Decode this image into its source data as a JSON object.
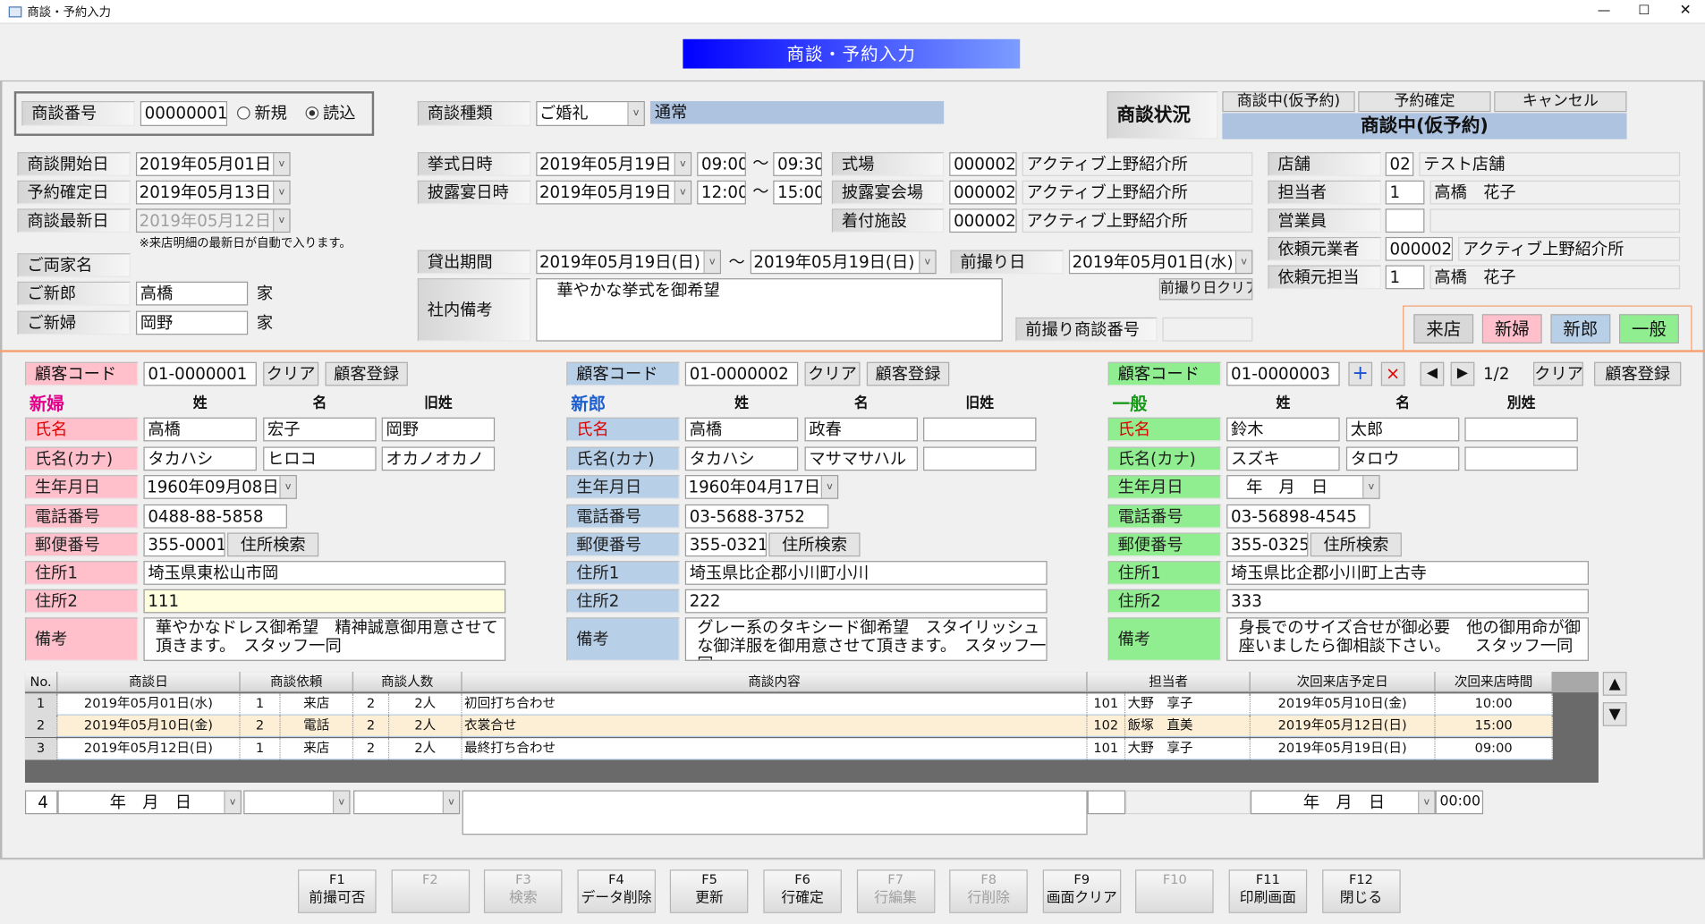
{
  "window": {
    "title": "商談・予約入力",
    "minimize": "—",
    "maximize": "☐",
    "close": "✕",
    "icon": "form-icon"
  },
  "banner": "商談・予約入力",
  "header": {
    "no_label": "商談番号",
    "no_value": "00000001",
    "radio_new": "新規",
    "radio_load": "読込",
    "radio_selected": "読込",
    "type_label": "商談種類",
    "type_value": "ご婚礼",
    "type_detail": "通常",
    "status_label": "商談状況",
    "status_tabs": [
      "商談中(仮予約)",
      "予約確定",
      "キャンセル"
    ],
    "status_value": "商談中(仮予約)"
  },
  "dates": [
    {
      "label": "商談開始日",
      "value": "2019年05月01日"
    },
    {
      "label": "予約確定日",
      "value": "2019年05月13日"
    },
    {
      "label": "商談最新日",
      "value": "2019年05月12日",
      "disabled": true
    }
  ],
  "note": "※来店明細の最新日が自動で入ります。",
  "family": {
    "label": "ご両家名",
    "groom_label": "ご新郎",
    "groom": "高橋",
    "bride_label": "ご新婦",
    "bride": "岡野",
    "suffix": "家"
  },
  "tilde": "～",
  "schedule": [
    {
      "label": "挙式日時",
      "date": "2019年05月19日",
      "start": "09:00",
      "end": "09:30"
    },
    {
      "label": "披露宴日時",
      "date": "2019年05月19日",
      "start": "12:00",
      "end": "15:00"
    }
  ],
  "venues": [
    {
      "label": "式場",
      "code": "000002",
      "name": "アクティブ上野紹介所"
    },
    {
      "label": "披露宴会場",
      "code": "000002",
      "name": "アクティブ上野紹介所"
    },
    {
      "label": "着付施設",
      "code": "000002",
      "name": "アクティブ上野紹介所"
    }
  ],
  "rental": {
    "label": "貸出期間",
    "from": "2019年05月19日(日)",
    "to": "2019年05月19日(日)"
  },
  "prephoto": {
    "label": "前撮り日",
    "date": "2019年05月01日(水)",
    "clear": "前撮り日クリア",
    "no_label": "前撮り商談番号",
    "no_value": ""
  },
  "memo": {
    "label": "社内備考",
    "value": "華やかな挙式を御希望"
  },
  "staff": [
    {
      "label": "店舗",
      "code": "02",
      "name": "テスト店舗"
    },
    {
      "label": "担当者",
      "code": "1",
      "name": "高橋　花子"
    },
    {
      "label": "営業員",
      "code": "",
      "name": ""
    },
    {
      "label": "依頼元業者",
      "code": "000002",
      "name": "アクティブ上野紹介所"
    },
    {
      "label": "依頼元担当",
      "code": "1",
      "name": "高橋　花子"
    }
  ],
  "filters": [
    {
      "label": "来店",
      "color": "#d8d8d8"
    },
    {
      "label": "新婦",
      "color": "#ffc0cb"
    },
    {
      "label": "新郎",
      "color": "#b8cfe8"
    },
    {
      "label": "一般",
      "color": "#90ee90"
    }
  ],
  "customer_labels": [
    "氏名",
    "氏名(カナ)",
    "生年月日",
    "電話番号",
    "郵便番号",
    "住所1",
    "住所2",
    "備考"
  ],
  "code_label": "顧客コード",
  "clear": "クリア",
  "register": "顧客登録",
  "search": "住所検索",
  "pager": {
    "add": "+",
    "delete": "×",
    "prev": "◀",
    "next": "▶",
    "page": "1/2"
  },
  "customers": [
    {
      "section": "新婦",
      "section_color": "#e0008a",
      "color": "#ffc0cb",
      "code": "01-0000001",
      "cols": [
        "姓",
        "名",
        "旧姓"
      ],
      "name": [
        "高橋",
        "宏子",
        "岡野"
      ],
      "kana": [
        "タカハシ",
        "ヒロコ",
        "オカノオカノ"
      ],
      "birth": "1960年09月08日",
      "phone": "0488-88-5858",
      "zip": "355-0001",
      "addr1": "埼玉県東松山市岡",
      "addr2": "111",
      "memo": "華やかなドレス御希望　精神誠意御用意させて頂きます。　スタッフ一同"
    },
    {
      "section": "新郎",
      "section_color": "#1e5fd0",
      "color": "#b8cfe8",
      "code": "01-0000002",
      "cols": [
        "姓",
        "名",
        "旧姓"
      ],
      "name": [
        "高橋",
        "政春",
        ""
      ],
      "kana": [
        "タカハシ",
        "マサマサハル",
        ""
      ],
      "birth": "1960年04月17日",
      "phone": "03-5688-3752",
      "zip": "355-0321",
      "addr1": "埼玉県比企郡小川町小川",
      "addr2": "222",
      "memo": "グレー系のタキシード御希望　スタイリッシュな御洋服を御用意させて頂きます。　スタッフ一同"
    },
    {
      "section": "一般",
      "section_color": "#1a9a1a",
      "color": "#90ee90",
      "code": "01-0000003",
      "cols": [
        "姓",
        "名",
        "別姓"
      ],
      "name": [
        "鈴木",
        "太郎",
        ""
      ],
      "kana": [
        "スズキ",
        "タロウ",
        ""
      ],
      "birth": "　年　月　日",
      "phone": "03-56898-4545",
      "zip": "355-0325",
      "addr1": "埼玉県比企郡小川町上古寺",
      "addr2": "333",
      "memo": "身長でのサイズ合せが御必要　他の御用命が御座いましたら御相談下さい。　　スタッフ一同"
    }
  ],
  "grid": {
    "columns": [
      "No.",
      "商談日",
      "商談依頼",
      "商談人数",
      "商談内容",
      "担当者",
      "次回来店予定日",
      "次回来店時間"
    ],
    "rows": [
      [
        "1",
        "2019年05月01日(水)",
        "1",
        "来店",
        "2",
        "2人",
        "初回打ち合わせ",
        "101",
        "大野　享子",
        "2019年05月10日(金)",
        "10:00"
      ],
      [
        "2",
        "2019年05月10日(金)",
        "2",
        "電話",
        "2",
        "2人",
        "衣裳合せ",
        "102",
        "飯塚　直美",
        "2019年05月12日(日)",
        "15:00"
      ],
      [
        "3",
        "2019年05月12日(日)",
        "1",
        "来店",
        "2",
        "2人",
        "最終打ち合わせ",
        "101",
        "大野　享子",
        "2019年05月19日(日)",
        "09:00"
      ]
    ],
    "scroll_up": "▲",
    "scroll_down": "▼"
  },
  "new_row": {
    "no": "4",
    "date": "年　月　日",
    "next_date": "年　月　日",
    "time": "00:00"
  },
  "fkeys": [
    {
      "key": "F1",
      "label": "前撮可否"
    },
    {
      "key": "F2",
      "label": "",
      "disabled": true
    },
    {
      "key": "F3",
      "label": "検索",
      "disabled": true
    },
    {
      "key": "F4",
      "label": "データ削除"
    },
    {
      "key": "F5",
      "label": "更新"
    },
    {
      "key": "F6",
      "label": "行確定"
    },
    {
      "key": "F7",
      "label": "行編集",
      "disabled": true
    },
    {
      "key": "F8",
      "label": "行削除",
      "disabled": true
    },
    {
      "key": "F9",
      "label": "画面クリア"
    },
    {
      "key": "F10",
      "label": "",
      "disabled": true
    },
    {
      "key": "F11",
      "label": "印刷画面"
    },
    {
      "key": "F12",
      "label": "閉じる"
    }
  ]
}
